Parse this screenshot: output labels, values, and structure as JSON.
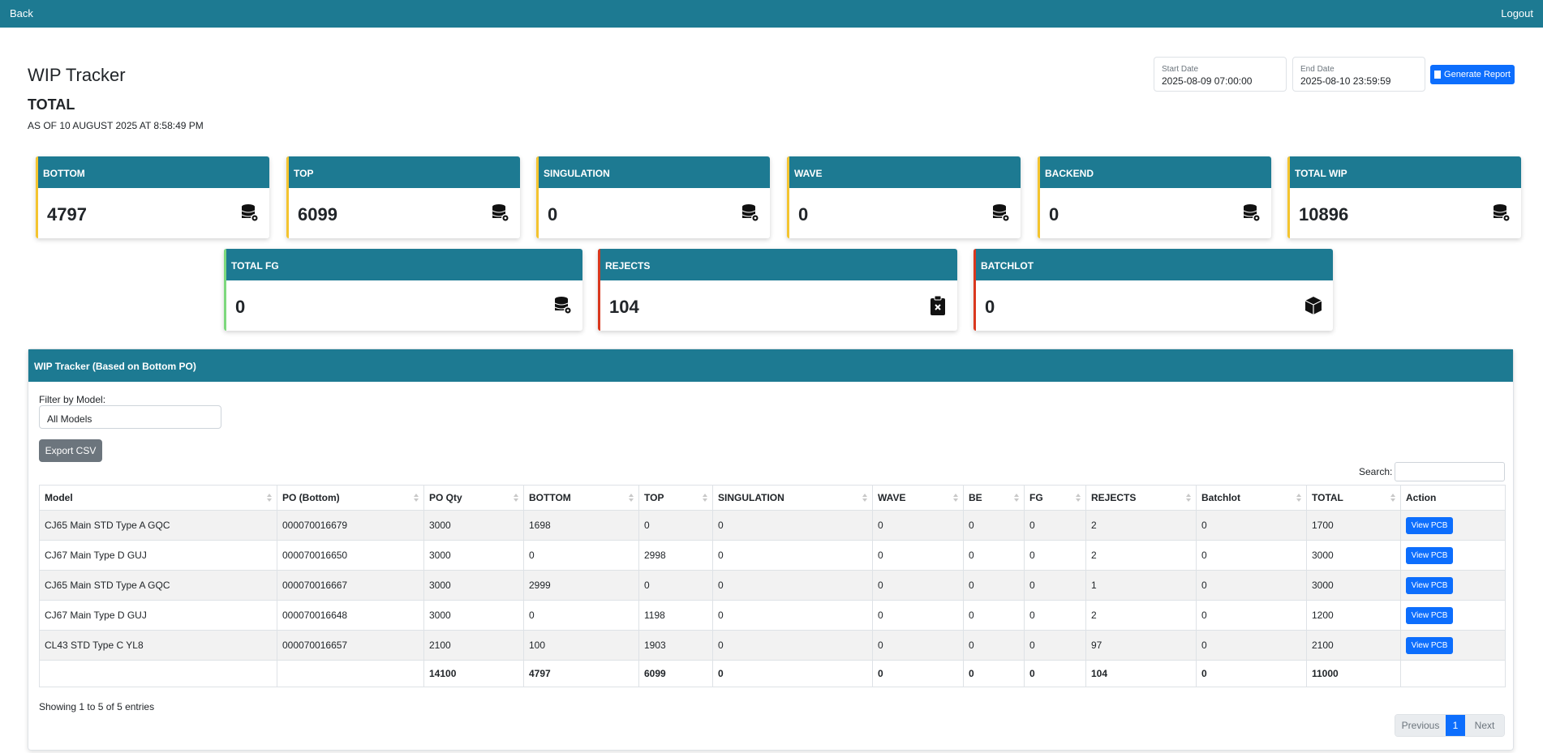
{
  "nav": {
    "back": "Back",
    "logout": "Logout"
  },
  "header": {
    "title": "WIP Tracker",
    "subtitle": "TOTAL",
    "as_of": "AS OF 10 AUGUST 2025 AT 8:58:49 PM"
  },
  "report": {
    "start_label": "Start Date",
    "start_value": "2025-08-09 07:00:00",
    "end_label": "End Date",
    "end_value": "2025-08-10 23:59:59",
    "generate_label": "Generate Report"
  },
  "cards": [
    {
      "title": "BOTTOM",
      "value": "4797",
      "icon": "database-gear-icon",
      "accent": "#f4c430"
    },
    {
      "title": "TOP",
      "value": "6099",
      "icon": "database-gear-icon",
      "accent": "#f4c430"
    },
    {
      "title": "SINGULATION",
      "value": "0",
      "icon": "database-gear-icon",
      "accent": "#f4c430"
    },
    {
      "title": "WAVE",
      "value": "0",
      "icon": "database-gear-icon",
      "accent": "#f4c430"
    },
    {
      "title": "BACKEND",
      "value": "0",
      "icon": "database-gear-icon",
      "accent": "#f4c430"
    },
    {
      "title": "TOTAL WIP",
      "value": "10896",
      "icon": "database-gear-icon",
      "accent": "#f4c430"
    },
    {
      "title": "TOTAL FG",
      "value": "0",
      "icon": "database-gear-icon",
      "accent": "#7dd87d"
    },
    {
      "title": "REJECTS",
      "value": "104",
      "icon": "clipboard-x-icon",
      "accent": "#d9381e"
    },
    {
      "title": "BATCHLOT",
      "value": "0",
      "icon": "box-icon",
      "accent": "#d9381e"
    }
  ],
  "panel": {
    "title": "WIP Tracker (Based on Bottom PO)",
    "filter_label": "Filter by Model:",
    "filter_value": "All Models",
    "export_label": "Export CSV",
    "search_label": "Search:",
    "columns": [
      "Model",
      "PO (Bottom)",
      "PO Qty",
      "BOTTOM",
      "TOP",
      "SINGULATION",
      "WAVE",
      "BE",
      "FG",
      "REJECTS",
      "Batchlot",
      "TOTAL",
      "Action"
    ],
    "rows": [
      [
        "CJ65 Main STD Type A GQC",
        "000070016679",
        "3000",
        "1698",
        "0",
        "0",
        "0",
        "0",
        "0",
        "2",
        "0",
        "1700"
      ],
      [
        "CJ67 Main Type D GUJ",
        "000070016650",
        "3000",
        "0",
        "2998",
        "0",
        "0",
        "0",
        "0",
        "2",
        "0",
        "3000"
      ],
      [
        "CJ65 Main STD Type A GQC",
        "000070016667",
        "3000",
        "2999",
        "0",
        "0",
        "0",
        "0",
        "0",
        "1",
        "0",
        "3000"
      ],
      [
        "CJ67 Main Type D GUJ",
        "000070016648",
        "3000",
        "0",
        "1198",
        "0",
        "0",
        "0",
        "0",
        "2",
        "0",
        "1200"
      ],
      [
        "CL43 STD Type C YL8",
        "000070016657",
        "2100",
        "100",
        "1903",
        "0",
        "0",
        "0",
        "0",
        "97",
        "0",
        "2100"
      ]
    ],
    "row_action": "View PCB",
    "totals": [
      "",
      "",
      "14100",
      "4797",
      "6099",
      "0",
      "0",
      "0",
      "0",
      "104",
      "0",
      "11000",
      ""
    ],
    "info": "Showing 1 to 5 of 5 entries",
    "pager": {
      "prev": "Previous",
      "current": "1",
      "next": "Next"
    }
  }
}
